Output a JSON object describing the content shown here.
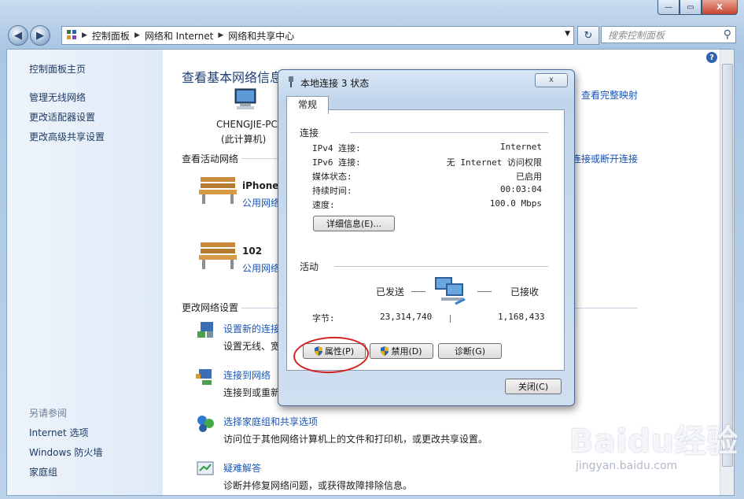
{
  "window": {
    "caption_buttons": [
      "—",
      "▭",
      "X"
    ]
  },
  "navbar": {
    "breadcrumb": [
      "控制面板",
      "网络和 Internet",
      "网络和共享中心"
    ],
    "search_placeholder": "搜索控制面板"
  },
  "sidebar": {
    "home": "控制面板主页",
    "links": [
      "管理无线网络",
      "更改适配器设置",
      "更改高级共享设置"
    ],
    "see_also_header": "另请参阅",
    "see_also": [
      "Internet 选项",
      "Windows 防火墙",
      "家庭组"
    ]
  },
  "main": {
    "title": "查看基本网络信息并设置连接",
    "view_full_map": "查看完整映射",
    "computer_name": "CHENGJIE-PC",
    "computer_sub": "(此计算机)",
    "active_networks_header": "查看活动网络",
    "connect_disconnect": "连接或断开连接",
    "networks": [
      {
        "name": "iPhone",
        "type": "公用网络"
      },
      {
        "name": "102",
        "type": "公用网络"
      }
    ],
    "change_settings_header": "更改网络设置",
    "tasks": [
      {
        "title": "设置新的连接或网络",
        "desc": "设置无线、宽带、拨号、临时或 VPN 连接；或设置路由器或访问点。"
      },
      {
        "title": "连接到网络",
        "desc": "连接到或重新连接到无线、有线、拨号或 VPN 网络连接。"
      },
      {
        "title": "选择家庭组和共享选项",
        "desc": "访问位于其他网络计算机上的文件和打印机，或更改共享设置。"
      },
      {
        "title": "疑难解答",
        "desc": "诊断并修复网络问题，或获得故障排除信息。"
      }
    ]
  },
  "dialog": {
    "title": "本地连接 3 状态",
    "close_glyph": "x",
    "tab": "常规",
    "connection_header": "连接",
    "rows": [
      {
        "label": "IPv4 连接:",
        "value": "Internet"
      },
      {
        "label": "IPv6 连接:",
        "value": "无 Internet 访问权限"
      },
      {
        "label": "媒体状态:",
        "value": "已启用"
      },
      {
        "label": "持续时间:",
        "value": "00:03:04"
      },
      {
        "label": "速度:",
        "value": "100.0 Mbps"
      }
    ],
    "details_button": "详细信息(E)...",
    "activity_header": "活动",
    "sent_label": "已发送",
    "received_label": "已接收",
    "bytes_label": "字节:",
    "bytes_sent": "23,314,740",
    "bytes_received": "1,168,433",
    "properties_button": "属性(P)",
    "disable_button": "禁用(D)",
    "diagnose_button": "诊断(G)",
    "close_button": "关闭(C)"
  },
  "watermark": {
    "logo": "Baidu经验",
    "url": "jingyan.baidu.com"
  },
  "colors": {
    "link_blue": "#1b55b6",
    "annotation_red": "#d42020"
  }
}
